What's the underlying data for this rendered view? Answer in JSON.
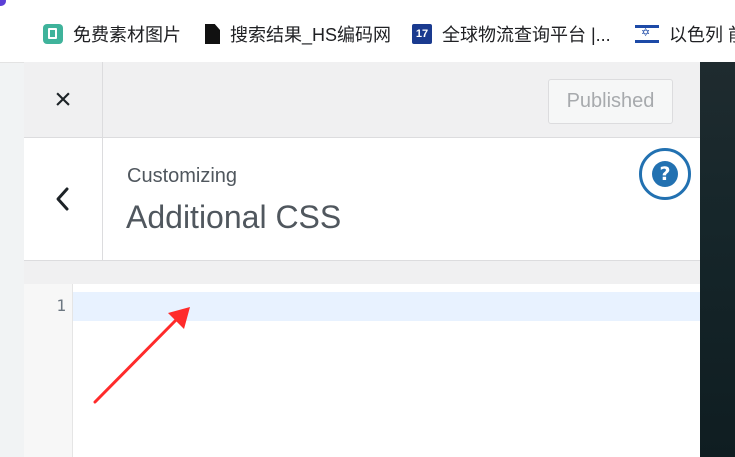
{
  "bookmarks": [
    {
      "label": "免费素材图片",
      "icon": "green-image-icon"
    },
    {
      "label": "搜索结果_HS编码网",
      "icon": "file-icon"
    },
    {
      "label": "全球物流查询平台 |...",
      "icon": "17track-icon"
    },
    {
      "label": "以色列 前",
      "icon": "israel-flag-icon"
    }
  ],
  "bookmark_17_text": "17",
  "customizer": {
    "close_icon": "×",
    "publish_label": "Published",
    "breadcrumb": "Customizing",
    "section_title": "Additional CSS",
    "help_icon": "?"
  },
  "editor": {
    "line_number": "1",
    "content": ""
  },
  "colors": {
    "accent": "#2271b1",
    "active_line": "#e8f2ff",
    "arrow": "#ff2b2b"
  }
}
